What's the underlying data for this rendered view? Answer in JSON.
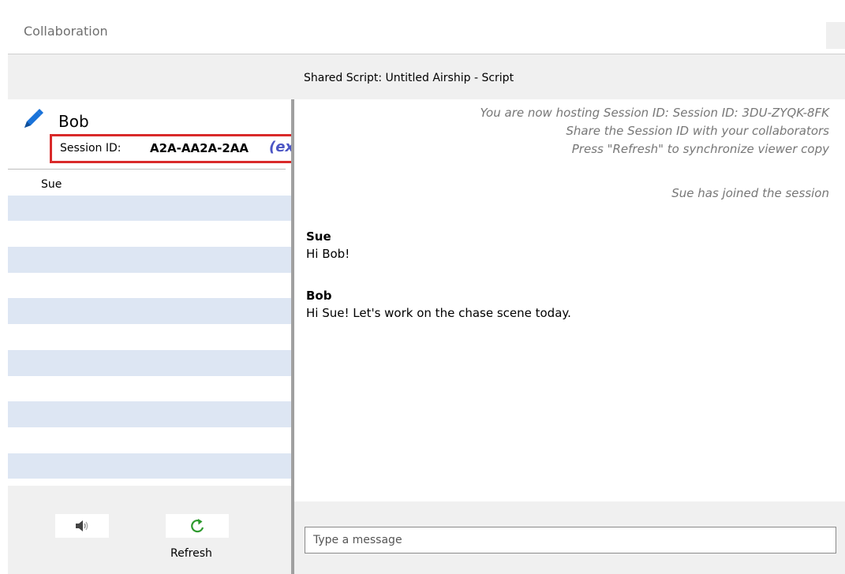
{
  "window": {
    "title": "Collaboration"
  },
  "header": {
    "shared_script": "Shared Script: Untitled Airship - Script"
  },
  "host": {
    "name": "Bob",
    "session_label": "Session ID:",
    "session_value": "A2A-AA2A-2AA",
    "session_example": "(example)"
  },
  "participants": [
    "Sue",
    "",
    "",
    "",
    "",
    "",
    "",
    "",
    "",
    "",
    "",
    "",
    "",
    "",
    "",
    ""
  ],
  "footer_left": {
    "refresh_label": "Refresh"
  },
  "chat": {
    "system_lines": [
      "You are now hosting Session ID: Session ID: 3DU-ZYQK-8FK",
      "Share the Session ID with your collaborators",
      "Press \"Refresh\" to synchronize viewer copy",
      "Sue has joined the session"
    ],
    "messages": [
      {
        "sender": "Sue",
        "text": "Hi Bob!"
      },
      {
        "sender": "Bob",
        "text": "Hi Sue!  Let's work on the chase scene today."
      }
    ],
    "input_placeholder": "Type a message"
  },
  "colors": {
    "accent_blue": "#1a73d9",
    "highlight_red": "#d92a2a",
    "example_text": "#4b55c4",
    "row_alt": "#dde6f3",
    "refresh_green": "#2e9a2e"
  },
  "icons": {
    "pencil": "pencil-icon",
    "speaker": "speaker-icon",
    "refresh": "refresh-icon",
    "close": "close-icon"
  }
}
